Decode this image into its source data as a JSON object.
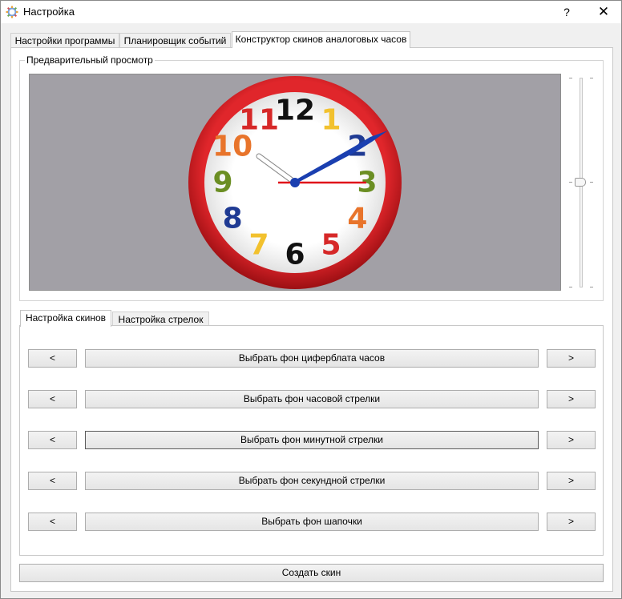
{
  "window": {
    "title": "Настройка",
    "help": "?",
    "close": "✕"
  },
  "main_tabs": [
    "Настройки программы",
    "Планировщик событий",
    "Конструктор скинов аналоговых часов"
  ],
  "preview": {
    "group_title": "Предварительный просмотр"
  },
  "clock": {
    "numerals": [
      {
        "text": "12",
        "color": "#111111"
      },
      {
        "text": "1",
        "color": "#f2c12e"
      },
      {
        "text": "2",
        "color": "#1f3a93"
      },
      {
        "text": "3",
        "color": "#6b8e23"
      },
      {
        "text": "4",
        "color": "#e8742b"
      },
      {
        "text": "5",
        "color": "#d62828"
      },
      {
        "text": "6",
        "color": "#111111"
      },
      {
        "text": "7",
        "color": "#f2c12e"
      },
      {
        "text": "8",
        "color": "#1f3a93"
      },
      {
        "text": "9",
        "color": "#6b8e23"
      },
      {
        "text": "10",
        "color": "#e8742b"
      },
      {
        "text": "11",
        "color": "#d62828"
      }
    ],
    "rim_color": "#c8171b",
    "hour_hand_color": "#ffffff",
    "minute_hand_color": "#1a3fb0",
    "second_hand_color": "#e0101a"
  },
  "sub_tabs": [
    "Настройка скинов",
    "Настройка стрелок"
  ],
  "skin_rows": [
    {
      "prev": "<",
      "label": "Выбрать фон циферблата часов",
      "next": ">"
    },
    {
      "prev": "<",
      "label": "Выбрать фон часовой стрелки",
      "next": ">"
    },
    {
      "prev": "<",
      "label": "Выбрать фон минутной стрелки",
      "next": ">"
    },
    {
      "prev": "<",
      "label": "Выбрать фон секундной стрелки",
      "next": ">"
    },
    {
      "prev": "<",
      "label": "Выбрать фон шапочки",
      "next": ">"
    }
  ],
  "create_button": "Создать скин"
}
